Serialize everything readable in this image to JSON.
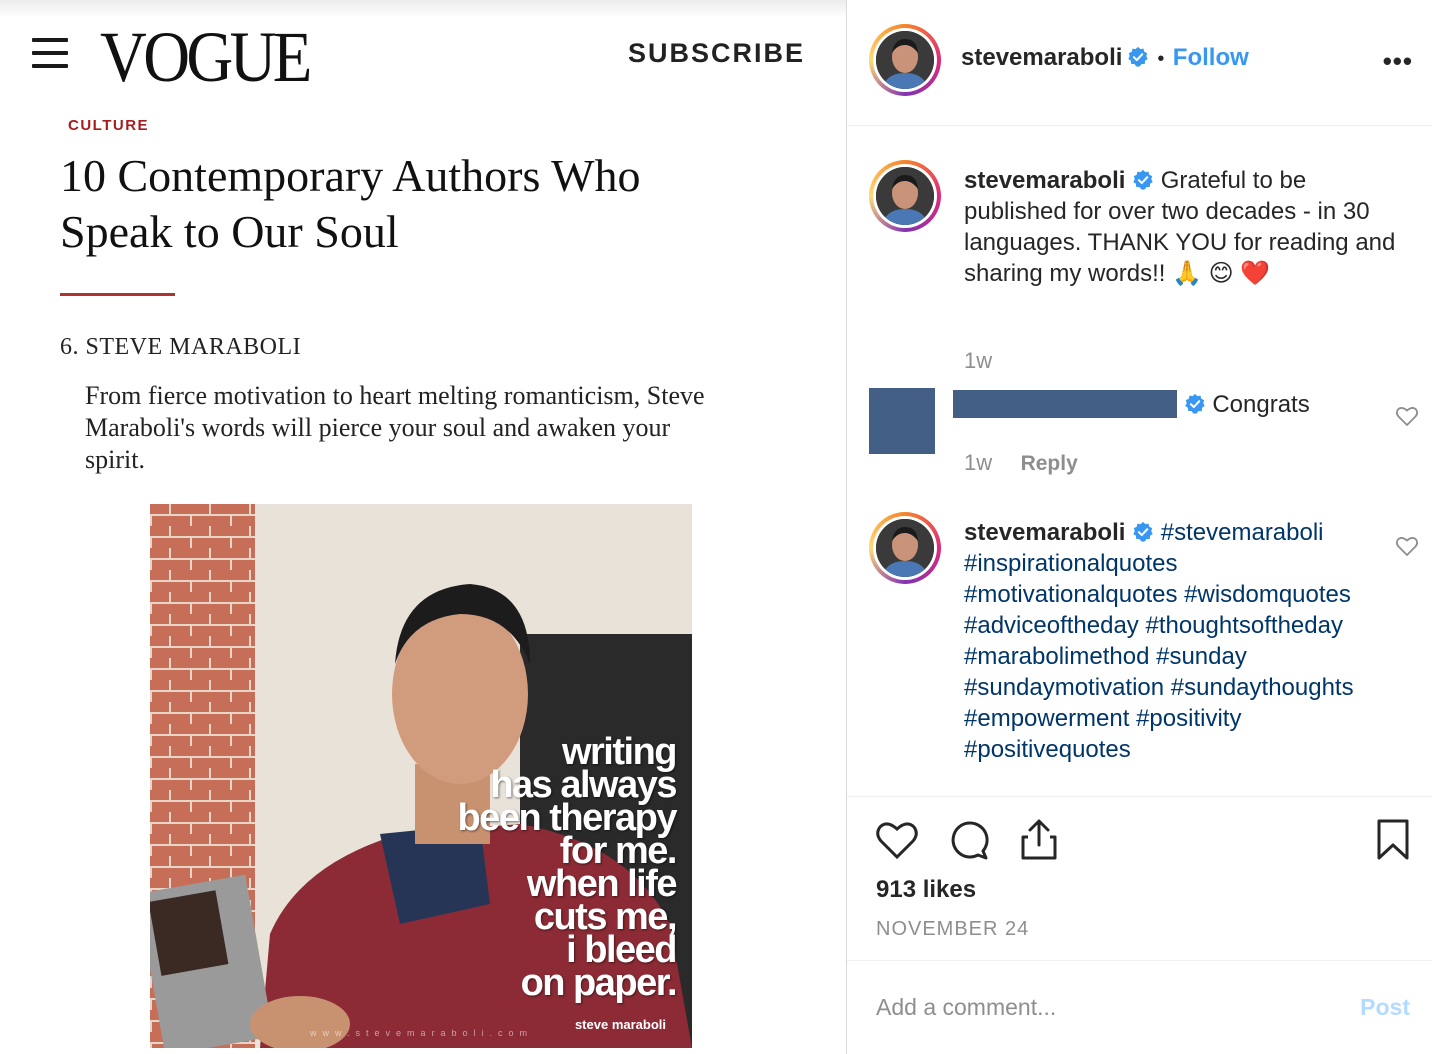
{
  "vogue": {
    "logo": "VOGUE",
    "subscribe_label": "SUBSCRIBE",
    "category": "CULTURE",
    "headline": "10 Contemporary Authors Who Speak to Our Soul",
    "item_title": "6. STEVE MARABOLI",
    "blurb": "From fierce motivation to heart melting romanticism, Steve Maraboli's words will pierce your soul and awaken your spirit.",
    "image": {
      "quote_lines": [
        "writing",
        "has always",
        "been therapy",
        "for me.",
        "when life",
        "cuts me,",
        "i bleed",
        "on paper."
      ],
      "signature": "steve maraboli",
      "url": "www.stevemaraboli.com"
    }
  },
  "instagram": {
    "header": {
      "username": "stevemaraboli",
      "separator": "•",
      "follow_label": "Follow",
      "more_label": "•••"
    },
    "caption": {
      "username": "stevemaraboli",
      "text": "Grateful to be published for over two decades - in 30 languages. THANK YOU for reading and sharing my words!! 🙏 😊 ❤️",
      "time": "1w"
    },
    "comment": {
      "text": "Congrats",
      "time": "1w",
      "reply_label": "Reply"
    },
    "hashtag_comment": {
      "username": "stevemaraboli",
      "hashtags": "#stevemaraboli #inspirationalquotes #motivationalquotes #wisdomquotes #adviceoftheday #thoughtsoftheday #marabolimethod #sunday #sundaymotivation #sundaythoughts #empowerment #positivity #positivequotes"
    },
    "likes": "913 likes",
    "date": "NOVEMBER 24",
    "comment_placeholder": "Add a comment...",
    "post_label": "Post",
    "colors": {
      "link": "#3897f0",
      "hashtag": "#003569",
      "muted": "#8e8e8e",
      "redaction": "#435f86"
    }
  }
}
